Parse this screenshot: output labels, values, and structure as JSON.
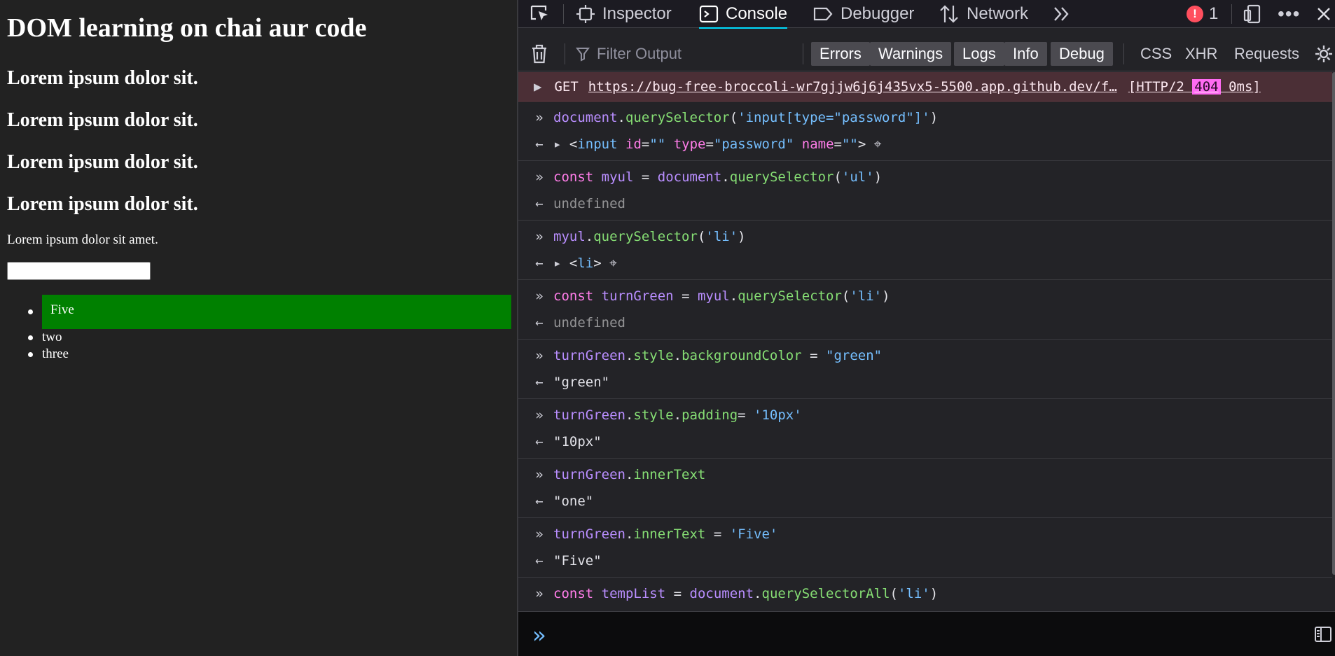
{
  "page": {
    "heading": "DOM learning on chai aur code",
    "subheadings": [
      "Lorem ipsum dolor sit.",
      "Lorem ipsum dolor sit.",
      "Lorem ipsum dolor sit.",
      "Lorem ipsum dolor sit."
    ],
    "paragraph": "Lorem ipsum dolor sit amet.",
    "input_value": "",
    "list_items": [
      "Five",
      "two",
      "three"
    ]
  },
  "devtools": {
    "tabs": [
      "Inspector",
      "Console",
      "Debugger",
      "Network"
    ],
    "active_tab": "Console",
    "error_count": "1",
    "filter_placeholder": "Filter Output",
    "filter_buttons": [
      "Errors",
      "Warnings",
      "Logs",
      "Info",
      "Debug"
    ],
    "type_buttons": [
      "CSS",
      "XHR",
      "Requests"
    ],
    "network_error": {
      "method": "GET",
      "url": "https://bug-free-broccoli-wr7gjjw6j6j435vx5-5500.app.github.dev/f…",
      "protocol": "[HTTP/2",
      "code": "404",
      "time": "0ms]"
    },
    "entries": [
      {
        "input": "document.querySelector('input[type=\"password\"]')",
        "output": "<input id=\"\" type=\"password\" name=\"\">"
      },
      {
        "input": "const myul = document.querySelector('ul')",
        "output": "undefined"
      },
      {
        "input": "myul.querySelector('li')",
        "output": "<li>"
      },
      {
        "input": "const turnGreen = myul.querySelector('li')",
        "output": "undefined"
      },
      {
        "input": "turnGreen.style.backgroundColor = \"green\"",
        "output": "\"green\""
      },
      {
        "input": "turnGreen.style.padding= '10px'",
        "output": "\"10px\""
      },
      {
        "input": "turnGreen.innerText",
        "output": "\"one\""
      },
      {
        "input": "turnGreen.innerText = 'Five'",
        "output": "\"Five\""
      },
      {
        "input": "const tempList = document.querySelectorAll('li')",
        "output": ""
      }
    ],
    "colors": {
      "accent": "#00ddff",
      "error_row_bg": "#4b2f36",
      "error_badge": "#ff4f5e",
      "keyword": "#ff7de9",
      "variable": "#b98eff",
      "method": "#86de74",
      "string": "#75bfff"
    },
    "icons": [
      "element-picker-icon",
      "inspector-icon",
      "console-icon",
      "debugger-icon",
      "network-icon",
      "more-tabs-icon",
      "error-icon",
      "responsive-design-icon",
      "meatball-menu-icon",
      "close-icon",
      "trash-icon",
      "filter-icon",
      "settings-icon",
      "prompt-icon",
      "sidebar-toggle-icon"
    ]
  }
}
